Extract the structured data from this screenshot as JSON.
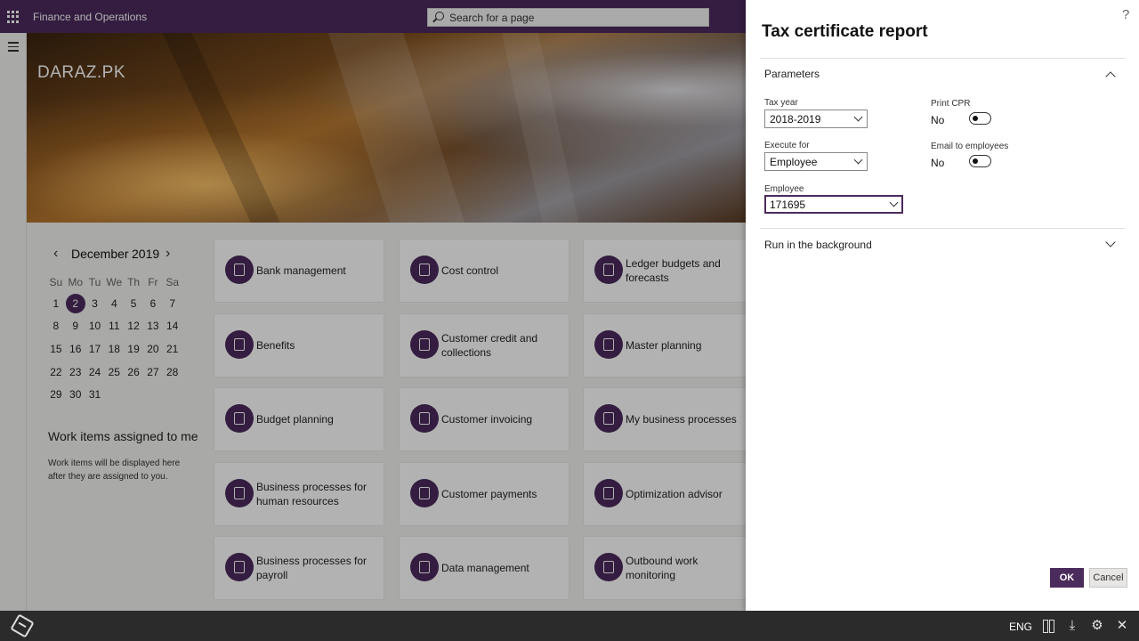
{
  "app": {
    "title": "Finance and Operations",
    "search_placeholder": "Search for a page",
    "company": "DARAZ.PK"
  },
  "calendar": {
    "month": "December",
    "year": "2019",
    "day_names": [
      "Su",
      "Mo",
      "Tu",
      "We",
      "Th",
      "Fr",
      "Sa"
    ],
    "days": [
      "1",
      "2",
      "3",
      "4",
      "5",
      "6",
      "7",
      "8",
      "9",
      "10",
      "11",
      "12",
      "13",
      "14",
      "15",
      "16",
      "17",
      "18",
      "19",
      "20",
      "21",
      "22",
      "23",
      "24",
      "25",
      "26",
      "27",
      "28",
      "29",
      "30",
      "31"
    ],
    "selected_day": "2"
  },
  "work_items": {
    "title": "Work items assigned to me",
    "empty_text": "Work items will be displayed here after they are assigned to you."
  },
  "tiles": [
    {
      "label": "Bank management",
      "icon": "bank-icon"
    },
    {
      "label": "Cost control",
      "icon": "cost-icon"
    },
    {
      "label": "Ledger budgets and forecasts",
      "icon": "ledger-icon"
    },
    {
      "label": "Benefits",
      "icon": "benefits-icon"
    },
    {
      "label": "Customer credit and collections",
      "icon": "credit-icon"
    },
    {
      "label": "Master planning",
      "icon": "planning-icon"
    },
    {
      "label": "Budget planning",
      "icon": "budget-icon"
    },
    {
      "label": "Customer invoicing",
      "icon": "invoice-icon"
    },
    {
      "label": "My business processes",
      "icon": "process-icon"
    },
    {
      "label": "Business processes for human resources",
      "icon": "hr-icon"
    },
    {
      "label": "Customer payments",
      "icon": "payments-icon"
    },
    {
      "label": "Optimization advisor",
      "icon": "advisor-icon"
    },
    {
      "label": "Business processes for payroll",
      "icon": "payroll-icon"
    },
    {
      "label": "Data management",
      "icon": "data-icon"
    },
    {
      "label": "Outbound work monitoring",
      "icon": "monitor-icon"
    }
  ],
  "dialog": {
    "help": "?",
    "title": "Tax certificate report",
    "parameters_header": "Parameters",
    "tax_year_label": "Tax year",
    "tax_year_value": "2018-2019",
    "execute_for_label": "Execute for",
    "execute_for_value": "Employee",
    "employee_label": "Employee",
    "employee_value": "171695",
    "print_cpr_label": "Print CPR",
    "print_cpr_value": "No",
    "email_label": "Email to employees",
    "email_value": "No",
    "background_header": "Run in the background",
    "ok_label": "OK",
    "cancel_label": "Cancel"
  },
  "taskbar": {
    "language": "ENG"
  },
  "colors": {
    "brand": "#4b2a5c",
    "taskbar": "#2b2b2b"
  }
}
